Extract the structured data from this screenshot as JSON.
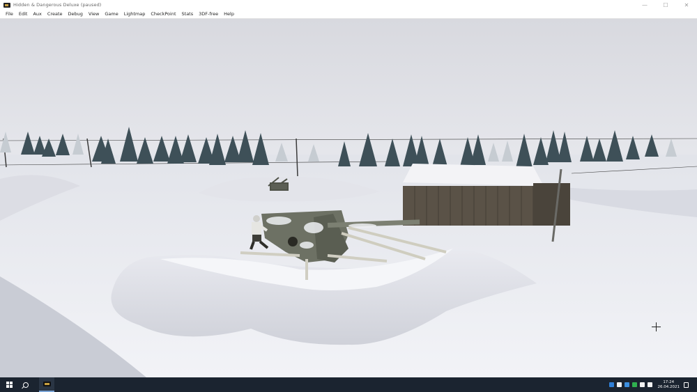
{
  "window": {
    "title": "Hidden & Dangerous Deluxe (paused)",
    "icon": "game-app-icon",
    "controls": {
      "minimize": "—",
      "maximize": "☐",
      "close": "✕"
    }
  },
  "menu": {
    "items": [
      "File",
      "Edit",
      "Aux",
      "Create",
      "Debug",
      "View",
      "Game",
      "Lightmap",
      "CheckPoint",
      "Stats",
      "3DF-free",
      "Help"
    ]
  },
  "scene": {
    "sky_color": "#dcdde3",
    "snow_color": "#eceef3",
    "fog_color": "#e4e5ea"
  },
  "taskbar": {
    "start_icon": "windows-logo-icon",
    "search_icon": "search-icon",
    "pinned_app_icon": "game-app-icon",
    "tray_icons": [
      {
        "name": "network-icon",
        "color": "#2f7fd6"
      },
      {
        "name": "app-tray-icon",
        "color": "#f2f2f2"
      },
      {
        "name": "bluetooth-icon",
        "color": "#3c8fe0"
      },
      {
        "name": "antivirus-icon",
        "color": "#2fb04f"
      },
      {
        "name": "volume-icon",
        "color": "#f2f2f2"
      },
      {
        "name": "keyboard-icon",
        "color": "#f2f2f2"
      }
    ],
    "time": "17:24",
    "date": "26.04.2021",
    "notification_icon": "notification-icon"
  }
}
